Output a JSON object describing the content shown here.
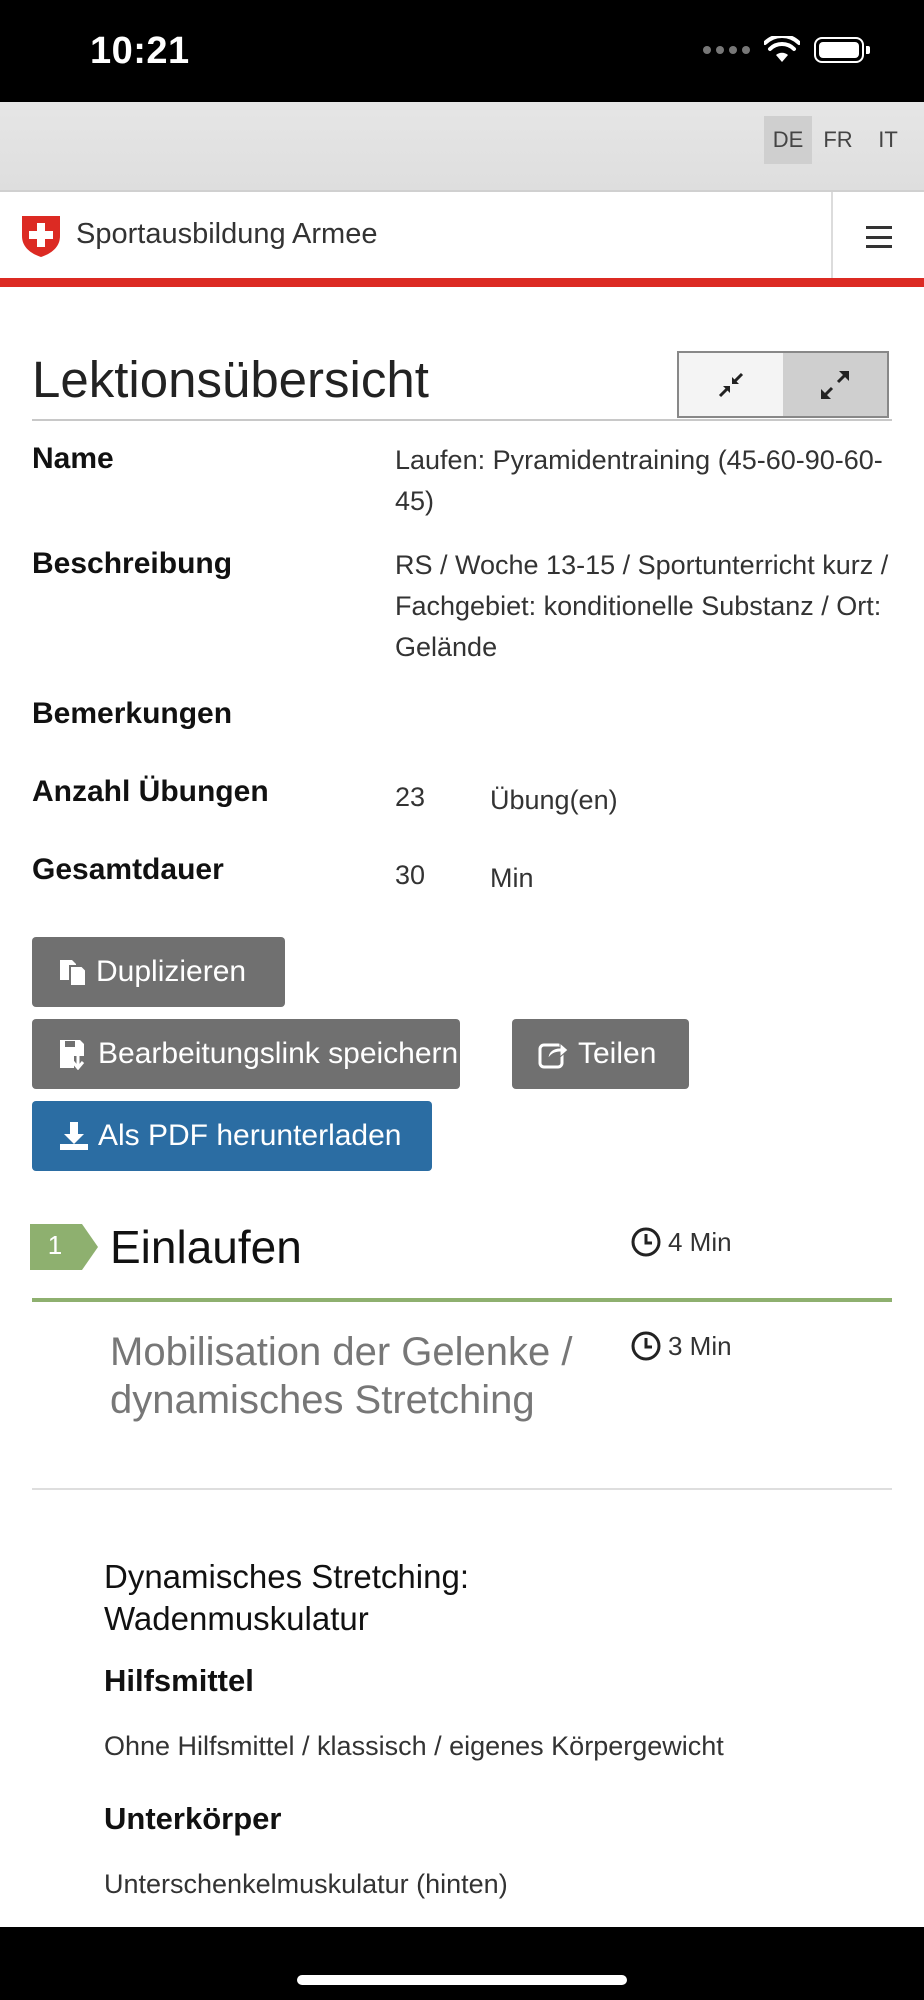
{
  "status": {
    "time": "10:21"
  },
  "languages": [
    {
      "code": "DE",
      "active": true
    },
    {
      "code": "FR",
      "active": false
    },
    {
      "code": "IT",
      "active": false
    }
  ],
  "header": {
    "brand": "Sportausbildung Armee"
  },
  "overview": {
    "title": "Lektionsübersicht",
    "fields": {
      "name_label": "Name",
      "name_value": "Laufen: Pyramidentraining (45-60-90-60-45)",
      "desc_label": "Beschreibung",
      "desc_value": "RS / Woche 13-15 / Sportunterricht kurz / Fachgebiet: konditionelle Substanz / Ort: Gelände",
      "remarks_label": "Bemerkungen",
      "count_label": "Anzahl Übungen",
      "count_value": "23",
      "count_unit": "Übung(en)",
      "duration_label": "Gesamtdauer",
      "duration_value": "30",
      "duration_unit": "Min"
    }
  },
  "buttons": {
    "duplicate": "Duplizieren",
    "save_link": "Bearbeitungslink speichern",
    "share": "Teilen",
    "pdf": "Als PDF herunterladen"
  },
  "section": {
    "number": "1",
    "title": "Einlaufen",
    "duration": "4 Min",
    "accent_color": "#8eb06f",
    "subsection": {
      "title": "Mobilisation der Gelenke / dynamisches Stretching",
      "duration": "3 Min"
    }
  },
  "exercise": {
    "title": "Dynamisches Stretching: Wadenmuskulatur",
    "aids_label": "Hilfsmittel",
    "aids_value": "Ohne Hilfsmittel / klassisch / eigenes Körpergewicht",
    "body_label": "Unterkörper",
    "body_value": "Unterschenkelmuskulatur (hinten)"
  },
  "colors": {
    "brand_red": "#dc2a23",
    "primary_blue": "#2b6da3",
    "button_gray": "#707070"
  }
}
